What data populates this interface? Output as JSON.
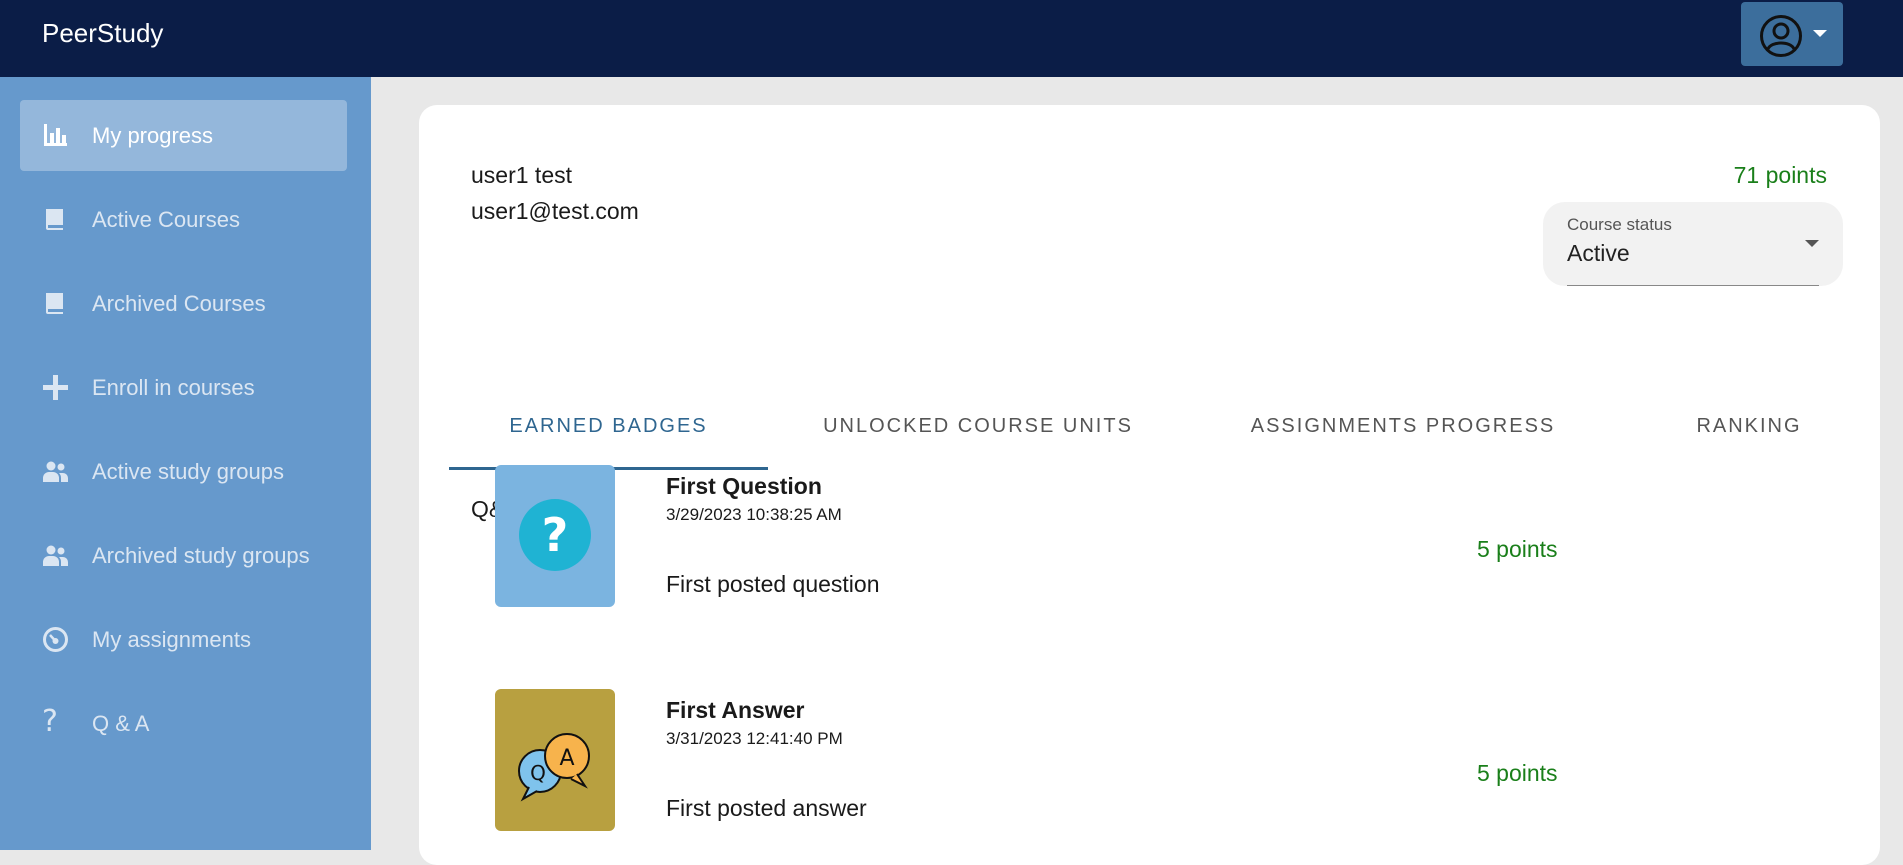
{
  "app": {
    "brand": "PeerStudy"
  },
  "header": {
    "account_icon": "account-circle-icon"
  },
  "sidebar": {
    "items": [
      {
        "label": "My progress",
        "icon": "bar-chart-icon",
        "active": true
      },
      {
        "label": "Active Courses",
        "icon": "book-icon",
        "active": false
      },
      {
        "label": "Archived Courses",
        "icon": "book-icon",
        "active": false
      },
      {
        "label": "Enroll in courses",
        "icon": "plus-icon",
        "active": false
      },
      {
        "label": "Active study groups",
        "icon": "group-icon",
        "active": false
      },
      {
        "label": "Archived study groups",
        "icon": "group-icon",
        "active": false
      },
      {
        "label": "My assignments",
        "icon": "gauge-icon",
        "active": false
      },
      {
        "label": "Q & A",
        "icon": "question-icon",
        "active": false
      }
    ]
  },
  "profile": {
    "name": "user1 test",
    "email": "user1@test.com",
    "points": "71 points"
  },
  "course_status": {
    "label": "Course status",
    "value": "Active"
  },
  "tabs": [
    {
      "label": "EARNED BADGES",
      "active": true
    },
    {
      "label": "UNLOCKED COURSE UNITS",
      "active": false
    },
    {
      "label": "ASSIGNMENTS PROGRESS",
      "active": false
    },
    {
      "label": "RANKING",
      "active": false
    }
  ],
  "section": {
    "title": "Q&A Badges"
  },
  "badges": [
    {
      "title": "First Question",
      "date": "3/29/2023 10:38:25 AM",
      "description": "First posted question",
      "points": "5 points",
      "icon": "question-badge-icon",
      "bg_color": "#7bb4e0"
    },
    {
      "title": "First Answer",
      "date": "3/31/2023 12:41:40 PM",
      "description": "First posted answer",
      "points": "5 points",
      "icon": "qa-bubbles-badge-icon",
      "bg_color": "#b8a040"
    }
  ],
  "colors": {
    "topbar": "#0b1d47",
    "sidebar": "#6699cc",
    "accent": "#2f6690",
    "points": "#1a7f1a"
  }
}
